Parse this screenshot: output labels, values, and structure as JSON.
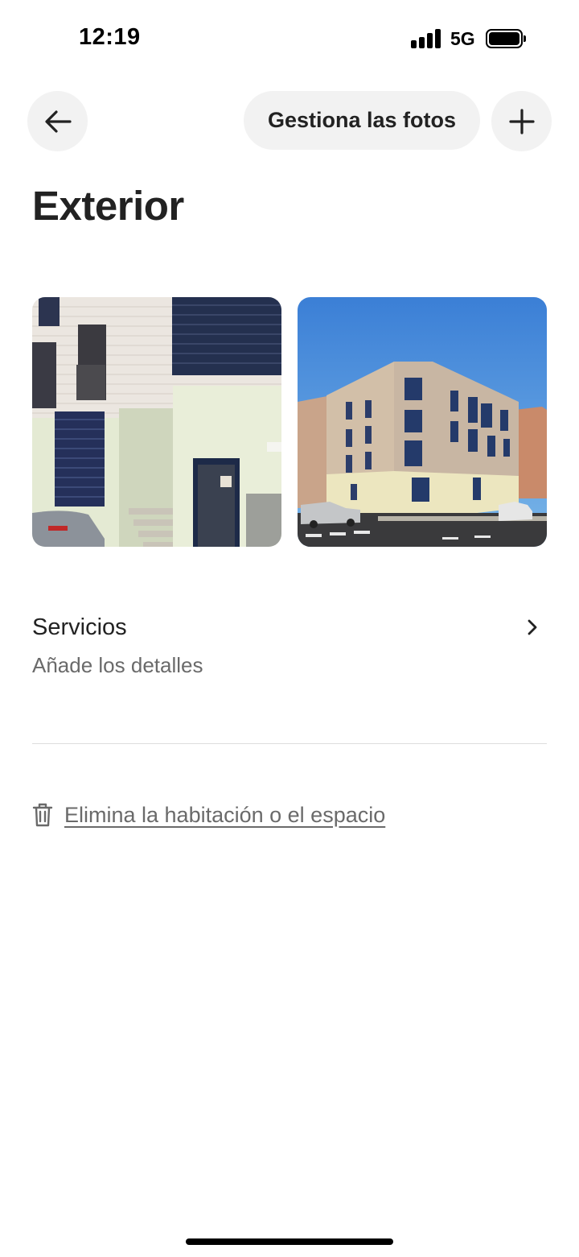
{
  "status_bar": {
    "time": "12:19",
    "network": "5G"
  },
  "header": {
    "manage_photos_label": "Gestiona las fotos"
  },
  "page": {
    "title": "Exterior"
  },
  "photos": [
    {
      "icon": "building-entrance-photo"
    },
    {
      "icon": "building-corner-photo"
    }
  ],
  "services": {
    "label": "Servicios",
    "subtitle": "Añade los detalles"
  },
  "delete": {
    "label": "Elimina la habitación o el espacio"
  },
  "colors": {
    "text_primary": "#222222",
    "text_secondary": "#6a6a6a",
    "button_bg": "#f2f2f2",
    "divider": "#dddddd"
  }
}
